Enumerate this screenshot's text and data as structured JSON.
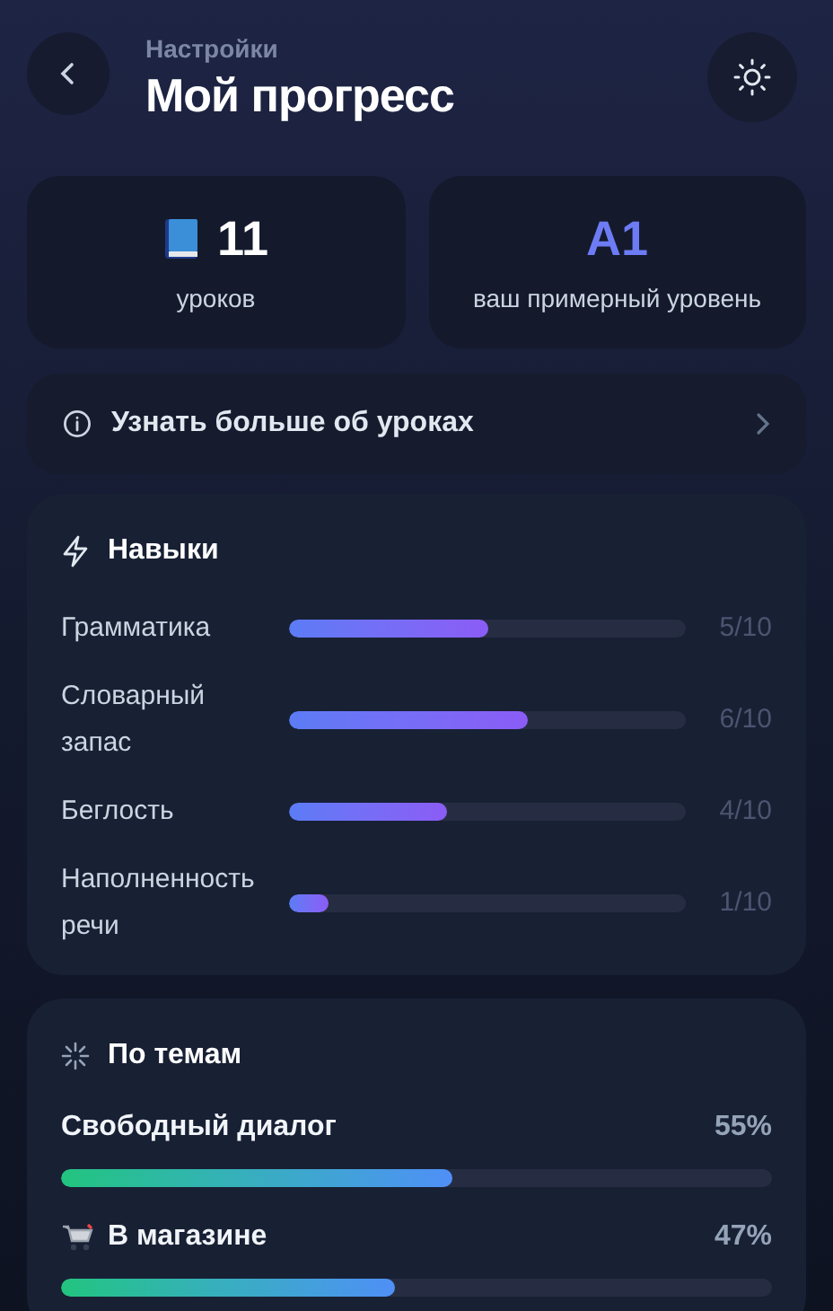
{
  "header": {
    "subtitle": "Настройки",
    "title": "Мой прогресс"
  },
  "stats": [
    {
      "value": "11",
      "label": "уроков",
      "kind": "lessons"
    },
    {
      "value": "A1",
      "label": "ваш примерный уровень",
      "kind": "level"
    }
  ],
  "info_link": {
    "label": "Узнать больше об уроках"
  },
  "skills": {
    "title": "Навыки",
    "items": [
      {
        "name": "Грамматика",
        "level": 0.5,
        "reading": "5/10"
      },
      {
        "name": "Словарный запас",
        "level": 0.6,
        "reading": "6/10"
      },
      {
        "name": "Беглость",
        "level": 0.4,
        "reading": "4/10"
      },
      {
        "name": "Наполненность речи",
        "level": 0.1,
        "reading": "1/10"
      }
    ]
  },
  "topics": {
    "title": "По темам",
    "items": [
      {
        "name": "Свободный диалог",
        "icon": false,
        "level": 0.55,
        "reading": "55%"
      },
      {
        "name": "В магазине",
        "icon": true,
        "level": 0.47,
        "reading": "47%"
      }
    ]
  }
}
